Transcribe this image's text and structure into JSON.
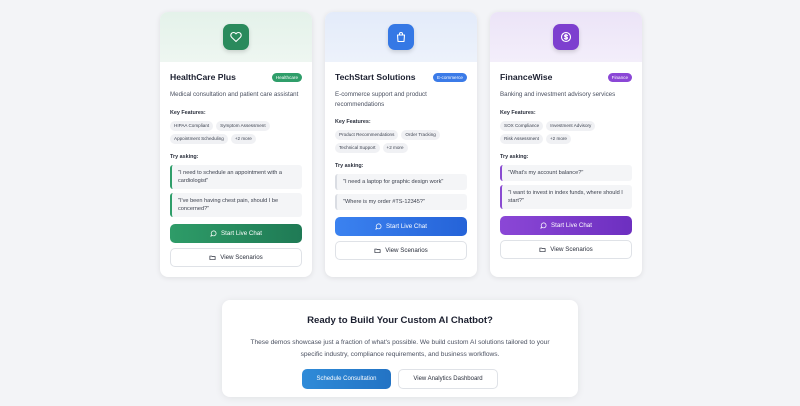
{
  "cards": [
    {
      "title": "HealthCare Plus",
      "badge": "Healthcare",
      "badge_color": "#2f9e6a",
      "icon": "heart-icon",
      "icon_color": "#2a8a5c",
      "description": "Medical consultation and patient care assistant",
      "features_label": "Key Features:",
      "features": [
        "HIPAA Compliant",
        "Symptom Assessment",
        "Appointment Scheduling",
        "+2 more"
      ],
      "try_label": "Try asking:",
      "prompts": [
        "\"I need to schedule an appointment with a cardiologist\"",
        "\"I've been having chest pain, should I be concerned?\""
      ],
      "chat_label": "Start Live Chat",
      "scenarios_label": "View Scenarios"
    },
    {
      "title": "TechStart Solutions",
      "badge": "E-commerce",
      "badge_color": "#3b7be8",
      "icon": "shopping-bag-icon",
      "icon_color": "#3578e5",
      "description": "E-commerce support and product recommendations",
      "features_label": "Key Features:",
      "features": [
        "Product Recommendations",
        "Order Tracking",
        "Technical Support",
        "+2 more"
      ],
      "try_label": "Try asking:",
      "prompts": [
        "\"I need a laptop for graphic design work\"",
        "\"Where is my order #TS-12345?\""
      ],
      "chat_label": "Start Live Chat",
      "scenarios_label": "View Scenarios"
    },
    {
      "title": "FinanceWise",
      "badge": "Finance",
      "badge_color": "#8b47d6",
      "icon": "dollar-coin-icon",
      "icon_color": "#7d3fcf",
      "description": "Banking and investment advisory services",
      "features_label": "Key Features:",
      "features": [
        "SOX Compliance",
        "Investment Advisory",
        "Risk Assessment",
        "+2 more"
      ],
      "try_label": "Try asking:",
      "prompts": [
        "\"What's my account balance?\"",
        "\"I want to invest in index funds, where should I start?\""
      ],
      "chat_label": "Start Live Chat",
      "scenarios_label": "View Scenarios"
    }
  ],
  "cta": {
    "title": "Ready to Build Your Custom AI Chatbot?",
    "text": "These demos showcase just a fraction of what's possible. We build custom AI solutions tailored to your specific industry, compliance requirements, and business workflows.",
    "primary_label": "Schedule Consultation",
    "secondary_label": "View Analytics Dashboard"
  }
}
